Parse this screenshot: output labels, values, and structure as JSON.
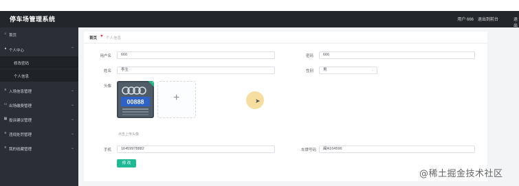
{
  "header": {
    "app_title": "停车场管理系统",
    "user_label": "用户 666",
    "backend_link": "退出到前台",
    "exit_label": "退出登录"
  },
  "sidebar": {
    "items": [
      {
        "label": "首页",
        "icon": "home-icon"
      },
      {
        "label": "个人中心",
        "icon": "user-icon",
        "expanded": true
      },
      {
        "label": "修改密码",
        "submenu": true
      },
      {
        "label": "个人信息",
        "submenu": true
      },
      {
        "label": "入场信息管理",
        "icon": "list-icon"
      },
      {
        "label": "出场缴费管理",
        "icon": "card-icon"
      },
      {
        "label": "投诉建议管理",
        "icon": "table-icon"
      },
      {
        "label": "违规处罚管理",
        "icon": "list-icon"
      },
      {
        "label": "我的收藏管理",
        "icon": "list-icon"
      }
    ]
  },
  "breadcrumb": {
    "home": "首页",
    "current": "个人信息"
  },
  "form": {
    "username_label": "用户名",
    "username_value": "666",
    "password_label": "密码",
    "password_value": "666",
    "name_label": "姓名",
    "name_value": "李生",
    "gender_label": "性别",
    "gender_value": "男",
    "avatar_label": "头像",
    "avatar_hint": "点击上传头像",
    "plate_image_text": "00888",
    "phone_label": "手机",
    "phone_value": "16459978882",
    "plate_label": "车牌号码",
    "plate_value": "闽A164596",
    "submit_label": "修 改"
  },
  "watermark": "@稀土掘金技术社区",
  "colors": {
    "topbar": "#23262b",
    "sidebar": "#2b2f35",
    "accent": "#1fb996",
    "heart": "#e0262a"
  }
}
